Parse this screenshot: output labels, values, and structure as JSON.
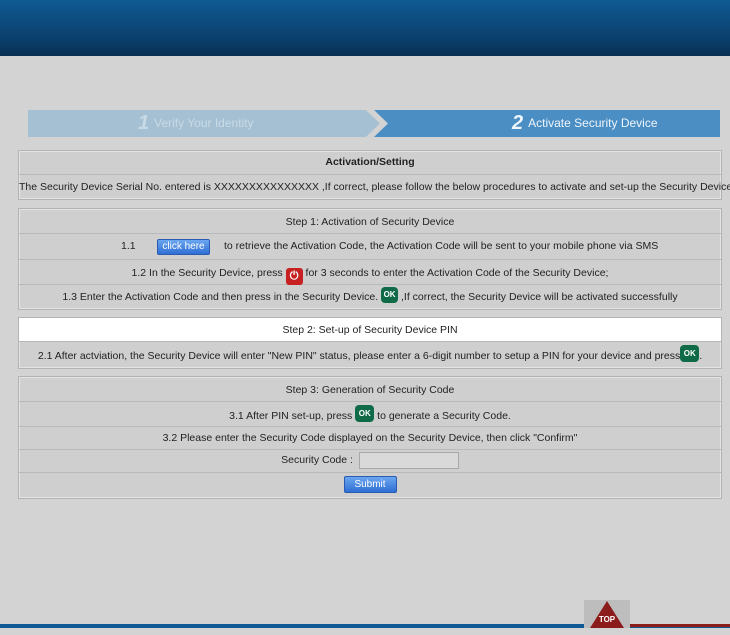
{
  "stepper": {
    "step1": {
      "number": "1",
      "label": "Verify Your Identity"
    },
    "step2": {
      "number": "2",
      "label": "Activate Security Device"
    }
  },
  "activation": {
    "title": "Activation/Setting",
    "serial_text": "The Security Device Serial No. entered is  XXXXXXXXXXXXXXX  ,If correct, please follow the below procedures to activate and set-up the Security Device :"
  },
  "step1_panel": {
    "title": "Step 1: Activation of Security Device",
    "r11_num": "1.1",
    "click_here_label": "click here",
    "r11_text": "to retrieve the Activation Code, the Activation Code will be sent to your mobile phone via SMS",
    "r12_pre": "1.2    In the Security Device, press",
    "r12_post": "for 3 seconds to enter the Activation Code of the Security Device;",
    "r13_pre": "1.3     Enter the Activation Code and then press in the Security Device.",
    "r13_post": ",If correct, the Security Device will be activated successfully"
  },
  "step2_panel": {
    "title": "Step 2: Set-up of Security Device PIN",
    "r21_pre": "2.1     After actviation, the Security Device will enter \"New PIN\" status, please enter a 6-digit number to setup a PIN for your device and press",
    "r21_post": "."
  },
  "step3_panel": {
    "title": "Step 3: Generation of Security Code",
    "r31_pre": "3.1     After PIN set-up, press",
    "r31_post": "to generate a Security Code.",
    "r32_text": "3.2    Please enter the Security Code displayed on the Security Device, then click \"Confirm\"",
    "code_label": "Security Code :",
    "code_value": "",
    "submit_label": "Submit"
  },
  "icons": {
    "ok": "OK",
    "power": "⏻"
  },
  "footer": {
    "top_label": "TOP"
  },
  "colors": {
    "header": "#0b3f6c",
    "step_active": "#4b8ec4",
    "step_done": "#a6c0d3",
    "button": "#2f6fd4",
    "ok_icon": "#0f6b47",
    "power_icon": "#c62020"
  }
}
